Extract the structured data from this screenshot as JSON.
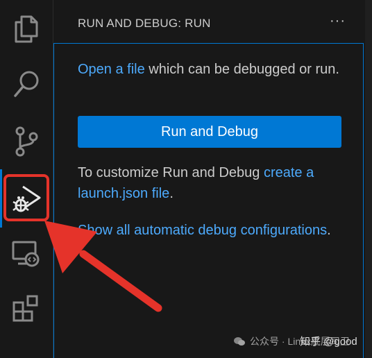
{
  "activity_bar": {
    "items": [
      {
        "name": "explorer",
        "icon": "files-icon"
      },
      {
        "name": "search",
        "icon": "search-icon"
      },
      {
        "name": "source-control",
        "icon": "source-control-icon"
      },
      {
        "name": "run-and-debug",
        "icon": "run-debug-icon",
        "active": true
      },
      {
        "name": "remote-explorer",
        "icon": "remote-explorer-icon"
      },
      {
        "name": "extensions",
        "icon": "extensions-icon"
      }
    ],
    "active_color": "#0078d4"
  },
  "sidebar": {
    "title": "RUN AND DEBUG: RUN",
    "more_actions": "···",
    "intro": {
      "link": "Open a file",
      "text": " which can be debugged or run."
    },
    "run_button_label": "Run and Debug",
    "customize": {
      "text_before": "To customize Run and Debug ",
      "link": "create a launch.json file",
      "text_after": "."
    },
    "auto_debug": {
      "link": "Show all automatic debug configurations",
      "text_after": "."
    }
  },
  "annotation": {
    "highlight_color": "#e5332a",
    "arrow_color": "#e5332a"
  },
  "watermark": {
    "text": "公众号 · Linux底层司卫",
    "overlay": "知乎 @good"
  },
  "colors": {
    "background": "#181818",
    "text": "#cccccc",
    "link": "#4daafc",
    "button": "#0078d4"
  }
}
